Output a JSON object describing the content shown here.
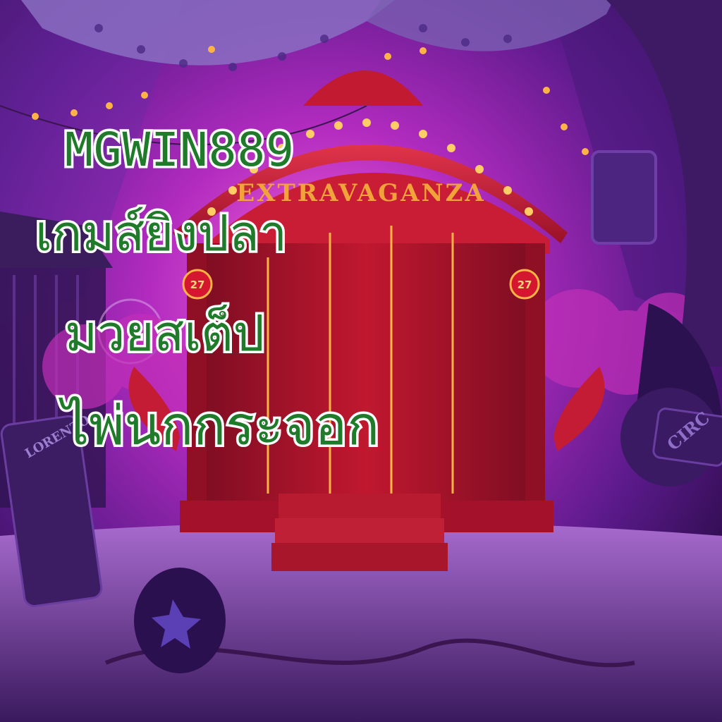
{
  "headline": {
    "brand": "MGWIN889",
    "line_fishing": "เกมส์ยิงปลา",
    "line_boxing": "มวยสเต็ป",
    "line_cards": "ไพ่นกกระจอก"
  },
  "wagon": {
    "marquee": "EXTRAVAGANZA",
    "badge_left": "27",
    "badge_right": "27"
  },
  "signs": {
    "left_sign": "LORENZO",
    "right_sign": "CIRC"
  },
  "colors": {
    "headline_fill": "#1f7a2a",
    "headline_outline": "#ffffff",
    "wagon_red": "#b8132b",
    "curtain_pink": "#c22fb8",
    "marquee_gold": "#f2a23a"
  }
}
